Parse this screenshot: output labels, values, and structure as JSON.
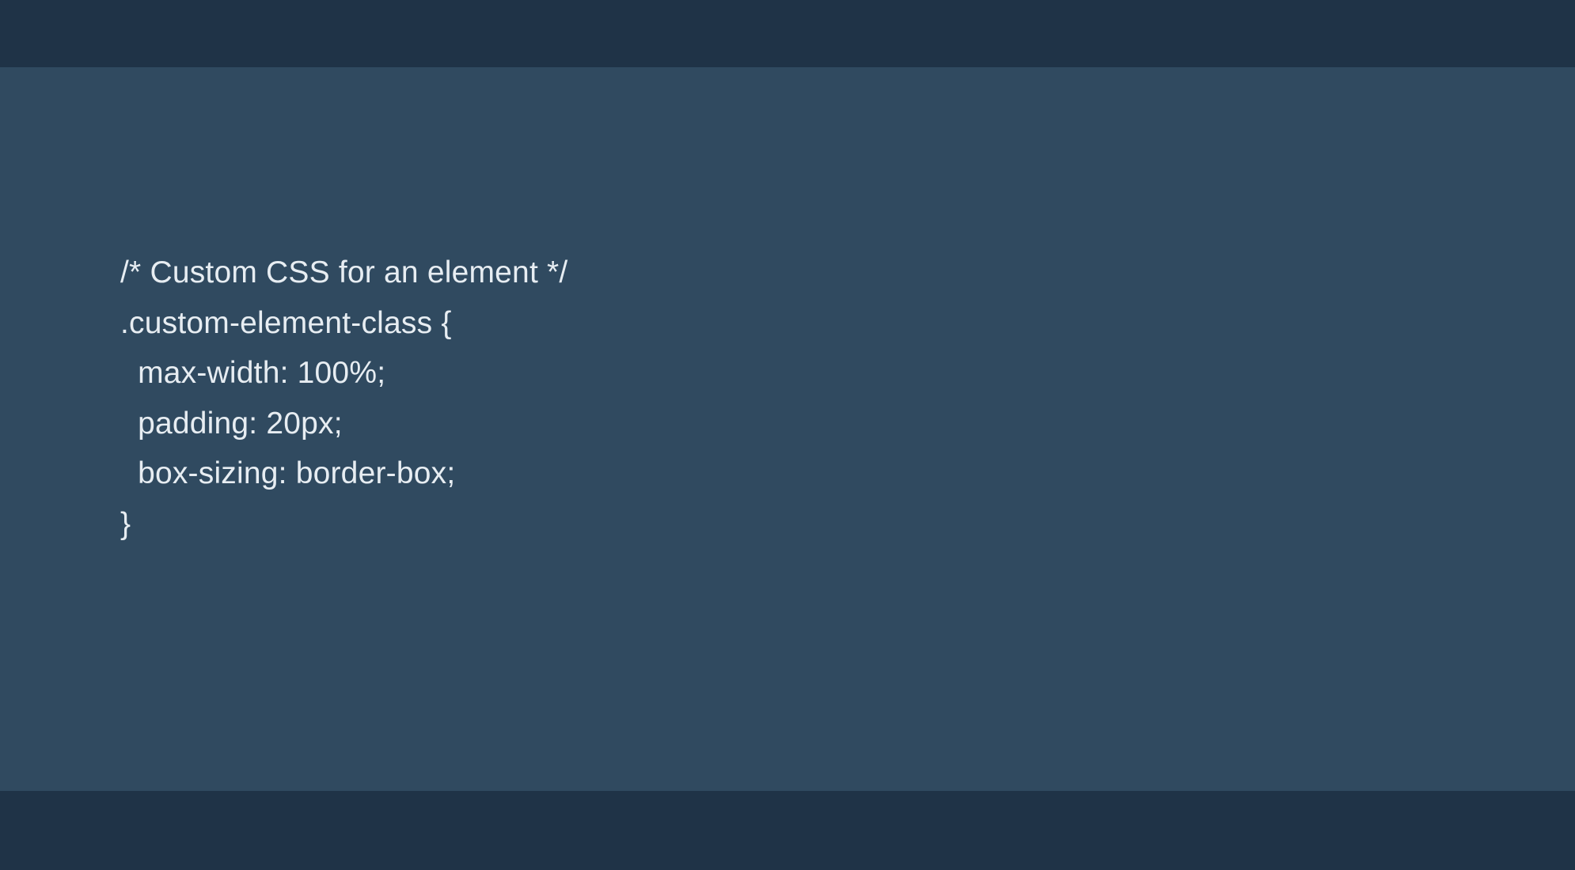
{
  "code": {
    "lines": [
      "/* Custom CSS for an element */",
      ".custom-element-class {",
      "  max-width: 100%;",
      "  padding: 20px;",
      "  box-sizing: border-box;",
      "}"
    ]
  },
  "colors": {
    "outer_band": "#1f3347",
    "panel": "#304a60",
    "text": "#e7edf2"
  }
}
